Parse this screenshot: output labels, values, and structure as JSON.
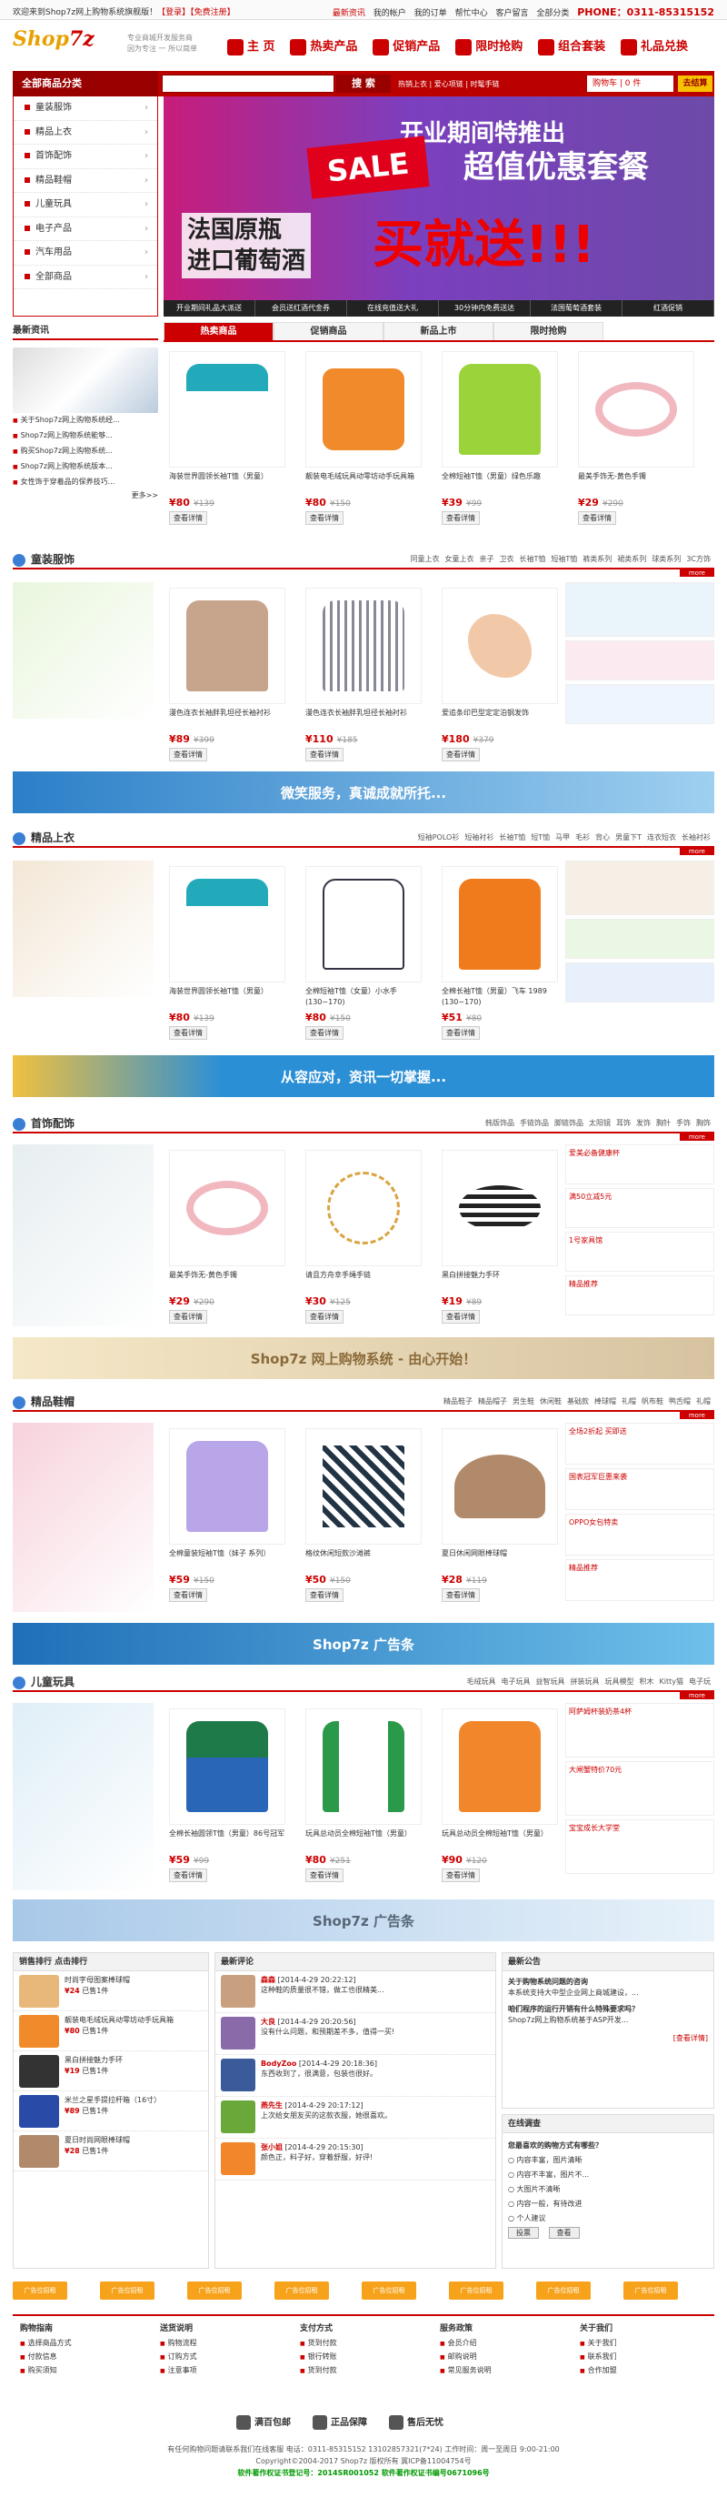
{
  "topbar": {
    "welcome": "欢迎来到Shop7z网上购物系统旗舰版！",
    "login": "【登录】",
    "register": "【免费注册】",
    "links": [
      "最新资讯",
      "我的帐户",
      "我的订单",
      "帮忙中心",
      "客户留言",
      "全部分类"
    ],
    "phone": "PHONE：0311-85315152"
  },
  "logo": {
    "brand1": "Shop",
    "brand2": "7z",
    "slogan1": "专业商城开发服务商",
    "slogan2": "因为专注 一 所以简单"
  },
  "mainnav": [
    "主 页",
    "热卖产品",
    "促销产品",
    "限时抢购",
    "组合套装",
    "礼品兑换"
  ],
  "navbar": {
    "category": "全部商品分类",
    "search_btn": "搜 索",
    "hot": "热销上衣 | 爱心项链 | 时髦手链",
    "cart": "购物车 | 0 件",
    "checkout": "去结算"
  },
  "sidebar": [
    "童装服饰",
    "精品上衣",
    "首饰配饰",
    "精品鞋帽",
    "儿童玩具",
    "电子产品",
    "汽车用品",
    "全部商品"
  ],
  "banner": {
    "t1": "开业期间特推出",
    "sale": "SALE",
    "t2": "超值优惠套餐",
    "t3a": "法国原瓶",
    "t3b": "进口葡萄酒",
    "t4": "买就送!!!",
    "strip": [
      "开业期间礼品大派送",
      "会员送红酒代金券",
      "在线充值送大礼",
      "30分钟内免费送达",
      "法国葡萄酒套装",
      "红酒促销"
    ]
  },
  "news": {
    "title": "最新资讯",
    "items": [
      "关于Shop7z网上购物系统经...",
      "Shop7z网上购物系统能够...",
      "购买Shop7z网上购物系统...",
      "Shop7z网上购物系统版本...",
      "女性饰于穿着品的保养技巧..."
    ],
    "more": "更多>>"
  },
  "tabs": [
    "热卖商品",
    "促销商品",
    "新品上市",
    "限时抢购"
  ],
  "common": {
    "view": "查看详情",
    "more": "more"
  },
  "row1": [
    {
      "name": "海装世界圆领长袖T恤（男童）",
      "price": "¥80",
      "old": "¥139"
    },
    {
      "name": "靓装电毛绒玩具动零坊动手玩具箱",
      "price": "¥80",
      "old": "¥150"
    },
    {
      "name": "全棉短袖T恤（男童）绿色乐趣",
      "price": "¥39",
      "old": "¥99"
    },
    {
      "name": "最美手饰无-黄色手镯",
      "price": "¥29",
      "old": "¥290"
    }
  ],
  "s1": {
    "title": "童装服饰",
    "links": [
      "同童上衣",
      "女童上衣",
      "亲子",
      "卫衣",
      "长袖T恤",
      "短袖T恤",
      "裤类系列",
      "裙类系列",
      "球类系列",
      "3C方饰"
    ]
  },
  "row2": [
    {
      "name": "漫色连衣长袖胖乳坦径长袖衬衫",
      "price": "¥89",
      "old": "¥399"
    },
    {
      "name": "漫色连衣长袖胖乳坦径长袖衬衫",
      "price": "¥110",
      "old": "¥185"
    },
    {
      "name": "爱追条印巴型定定泊钢发饰",
      "price": "¥180",
      "old": "¥379"
    }
  ],
  "ban1": "微笑服务，真诚成就所托...",
  "s2": {
    "title": "精品上衣",
    "links": [
      "短袖POLO衫",
      "短袖衬衫",
      "长袖T恤",
      "短T恤",
      "马甲",
      "毛衫",
      "背心",
      "男童下T",
      "连衣短衣",
      "长袖衬衫"
    ]
  },
  "row3": [
    {
      "name": "海装世界圆领长袖T恤（男童）",
      "price": "¥80",
      "old": "¥139"
    },
    {
      "name": "全棉短袖T恤（女童）小水手 (130~170)",
      "price": "¥80",
      "old": "¥150"
    },
    {
      "name": "全棉长袖T恤（男童）飞车 1989 (130~170)",
      "price": "¥51",
      "old": "¥80"
    }
  ],
  "ban2": "从容应对，资讯一切掌握...",
  "s3": {
    "title": "首饰配饰",
    "links": [
      "韩版饰品",
      "手链饰品",
      "脚链饰品",
      "太阳镜",
      "耳饰",
      "发饰",
      "胸针",
      "手饰",
      "胸饰"
    ]
  },
  "row4": [
    {
      "name": "最美手饰无-黄色手镯",
      "price": "¥29",
      "old": "¥290"
    },
    {
      "name": "请且方舟幸手绳手链",
      "price": "¥30",
      "old": "¥125"
    },
    {
      "name": "黑白拼接魅力手环",
      "price": "¥19",
      "old": "¥89"
    }
  ],
  "ads3": [
    "爱美必备健康杯",
    "满50立减5元",
    "1号家具馆",
    "精品推荐"
  ],
  "ban3": "Shop7z 网上购物系统 - 由心开始！",
  "s4": {
    "title": "精品鞋帽",
    "links": [
      "精品鞋子",
      "精品帽子",
      "男生鞋",
      "休闲鞋",
      "基础款",
      "棒球帽",
      "礼帽",
      "帆布鞋",
      "鸭舌帽",
      "礼帽"
    ]
  },
  "row5": [
    {
      "name": "全棉童装短袖T恤（妹子 系列）",
      "price": "¥59",
      "old": "¥150"
    },
    {
      "name": "格纹休闲短款沙滩裤",
      "price": "¥50",
      "old": "¥150"
    },
    {
      "name": "夏日休闲网眼棒球帽",
      "price": "¥28",
      "old": "¥119"
    }
  ],
  "ads4": [
    "全场2折起 买即送",
    "国表冠军巨惠来袭",
    "OPPO女包特卖",
    "精品推荐"
  ],
  "ban4": "Shop7z 广告条",
  "s5": {
    "title": "儿童玩具",
    "links": [
      "毛绒玩具",
      "电子玩具",
      "益智玩具",
      "拼装玩具",
      "玩具模型",
      "积木",
      "Kitty猫",
      "电子玩"
    ]
  },
  "row6": [
    {
      "name": "全棉长袖圆领T恤（男童）86号冠军",
      "price": "¥59",
      "old": "¥99"
    },
    {
      "name": "玩具总动员全棉短袖T恤（男童）",
      "price": "¥80",
      "old": "¥251"
    },
    {
      "name": "玩具总动员全棉短袖T恤（男童）",
      "price": "¥90",
      "old": "¥120"
    }
  ],
  "ads5": [
    "阿萨姆杯装奶茶4杯",
    "大闸蟹特价70元",
    "宝宝成长大学堂"
  ],
  "ban5": "Shop7z 广告条",
  "rank": {
    "title": "销售排行 点击排行",
    "items": [
      {
        "name": "时尚字母图案棒球帽",
        "price": "¥24",
        "sold": "已售1件"
      },
      {
        "name": "靓装电毛绒玩具动零坊动手玩具箱",
        "price": "¥80",
        "sold": "已售1件"
      },
      {
        "name": "黑白拼接魅力手环",
        "price": "¥19",
        "sold": "已售1件"
      },
      {
        "name": "米兰之星手提拉杆箱（16寸）",
        "price": "¥89",
        "sold": "已售1件"
      },
      {
        "name": "夏日时尚网眼棒球帽",
        "price": "¥28",
        "sold": "已售1件"
      }
    ]
  },
  "comments": {
    "title": "最新评论",
    "items": [
      {
        "user": "森森",
        "time": "[2014-4-29 20:22:12]",
        "text": "这种鞋的质量很不错，做工也很精美..."
      },
      {
        "user": "大良",
        "time": "[2014-4-29 20:20:56]",
        "text": "没有什么问题，和预期差不多，值得一买!"
      },
      {
        "user": "BodyZoo",
        "time": "[2014-4-29 20:18:36]",
        "text": "东西收到了，很满意，包装也很好。"
      },
      {
        "user": "燕先生",
        "time": "[2014-4-29 20:17:12]",
        "text": "上次给女朋友买的这款衣服，她很喜欢。"
      },
      {
        "user": "张小姐",
        "time": "[2014-4-29 20:15:30]",
        "text": "颜色正，料子好，穿着舒服，好评!"
      }
    ]
  },
  "notice": {
    "title": "最新公告",
    "q1": "关于购物系统问题的咨询",
    "a1": "本系统支持大中型企业网上商城建设，...",
    "q2": "咱们程序的运行开销有什么特殊要求吗？",
    "a2": "Shop7z网上购物系统基于ASP开发...",
    "detail": "[查看详情]"
  },
  "vote": {
    "title": "在线调查",
    "q": "您最喜欢的购物方式有哪些？",
    "opts": [
      "内容丰富，图片清晰",
      "内容不丰富，图片不...",
      "大图片不清晰",
      "内容一般，有待改进",
      "个人建议"
    ],
    "vote_btn": "投票",
    "view_btn": "查看"
  },
  "adrow": [
    "广告位招租",
    "广告位招租",
    "广告位招租",
    "广告位招租",
    "广告位招租",
    "广告位招租",
    "广告位招租",
    "广告位招租"
  ],
  "footer": [
    {
      "h": "购物指南",
      "i": [
        "选择商品方式",
        "付款信息",
        "购买须知"
      ]
    },
    {
      "h": "送货说明",
      "i": [
        "购物流程",
        "订购方式",
        "注意事项"
      ]
    },
    {
      "h": "支付方式",
      "i": [
        "货到付款",
        "银行转账",
        "货到付款"
      ]
    },
    {
      "h": "服务政策",
      "i": [
        "会员介绍",
        "邮购说明",
        "常见服务说明"
      ]
    },
    {
      "h": "关于我们",
      "i": [
        "关于我们",
        "联系我们",
        "合作加盟"
      ]
    }
  ],
  "guar": [
    "满百包邮",
    "正品保障",
    "售后无忧"
  ],
  "copy": {
    "l1": "有任何购物问题请联系我们在线客服  电话：0311-85315152 13102857321(7*24) 工作时间：周一至周日 9:00-21:00",
    "l2": "Copyright©2004-2017 Shop7z 版权所有 冀ICP备11004754号",
    "l3": "软件著作权证书登记号：2014SR001052 软件著作权证书编号0671096号"
  }
}
